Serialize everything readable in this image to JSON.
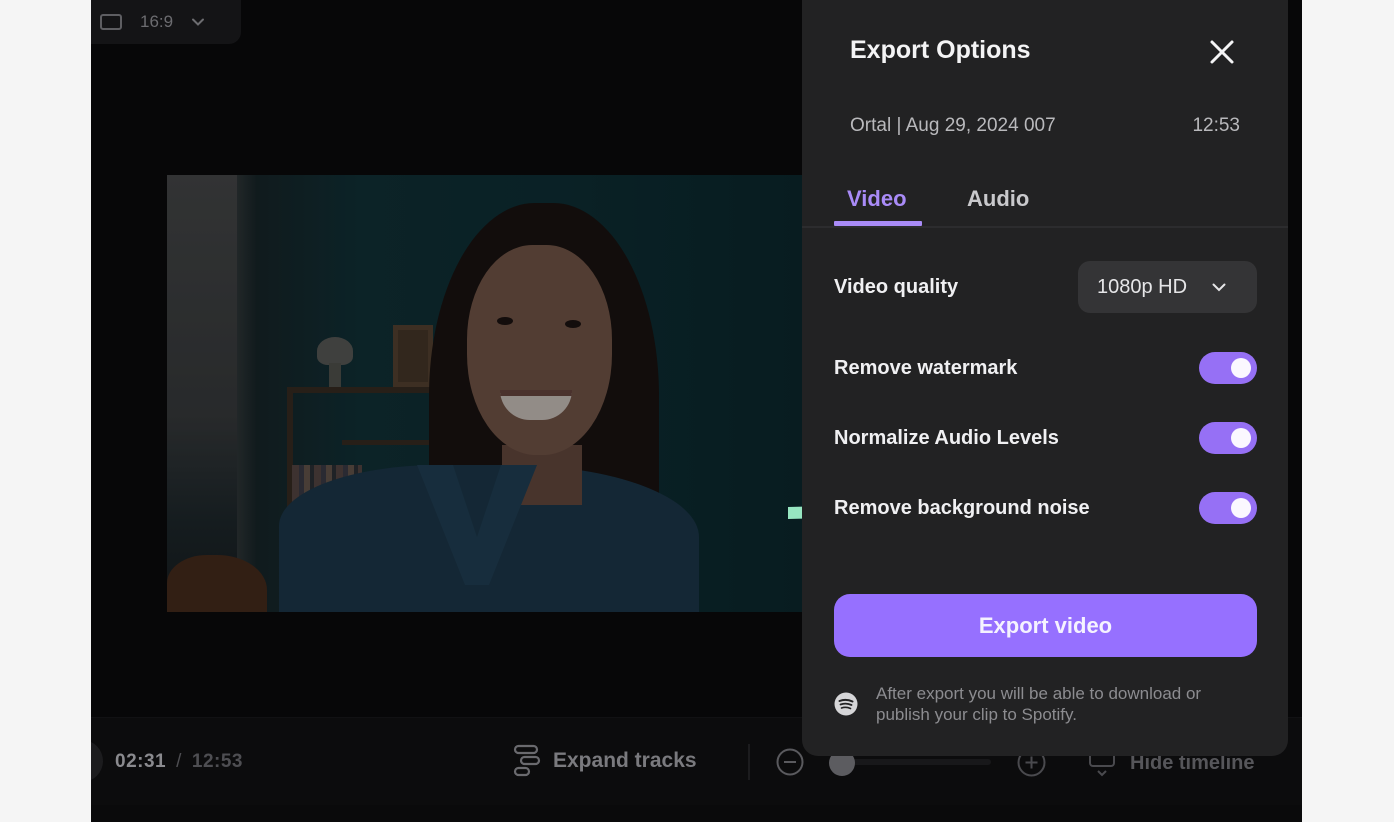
{
  "toolbar": {
    "aspect_ratio": "16:9"
  },
  "player": {
    "current_time": "02:31",
    "separator": "/",
    "total_time": "12:53",
    "expand_tracks_label": "Expand tracks",
    "hide_timeline_label": "Hide timeline",
    "zoom_level_fraction": 0.0
  },
  "export_panel": {
    "title": "Export Options",
    "meta_title": "Ortal | Aug 29, 2024 007",
    "meta_duration": "12:53",
    "tabs": [
      {
        "label": "Video",
        "active": true
      },
      {
        "label": "Audio",
        "active": false
      }
    ],
    "video_quality": {
      "label": "Video quality",
      "selected": "1080p HD"
    },
    "options": [
      {
        "label": "Remove watermark",
        "enabled": true
      },
      {
        "label": "Normalize Audio Levels",
        "enabled": true
      },
      {
        "label": "Remove background noise",
        "enabled": true
      }
    ],
    "export_button": "Export video",
    "note": "After export you will be able to download or publish your clip to Spotify."
  },
  "annotation": {
    "arrow_target": "Remove background noise",
    "arrow_color": "#97e6c1"
  },
  "colors": {
    "accent": "#9670ff",
    "tab_active": "#a98bf7",
    "panel_bg": "#222223",
    "app_bg": "#070708",
    "page_bg": "#f5f5f5"
  }
}
